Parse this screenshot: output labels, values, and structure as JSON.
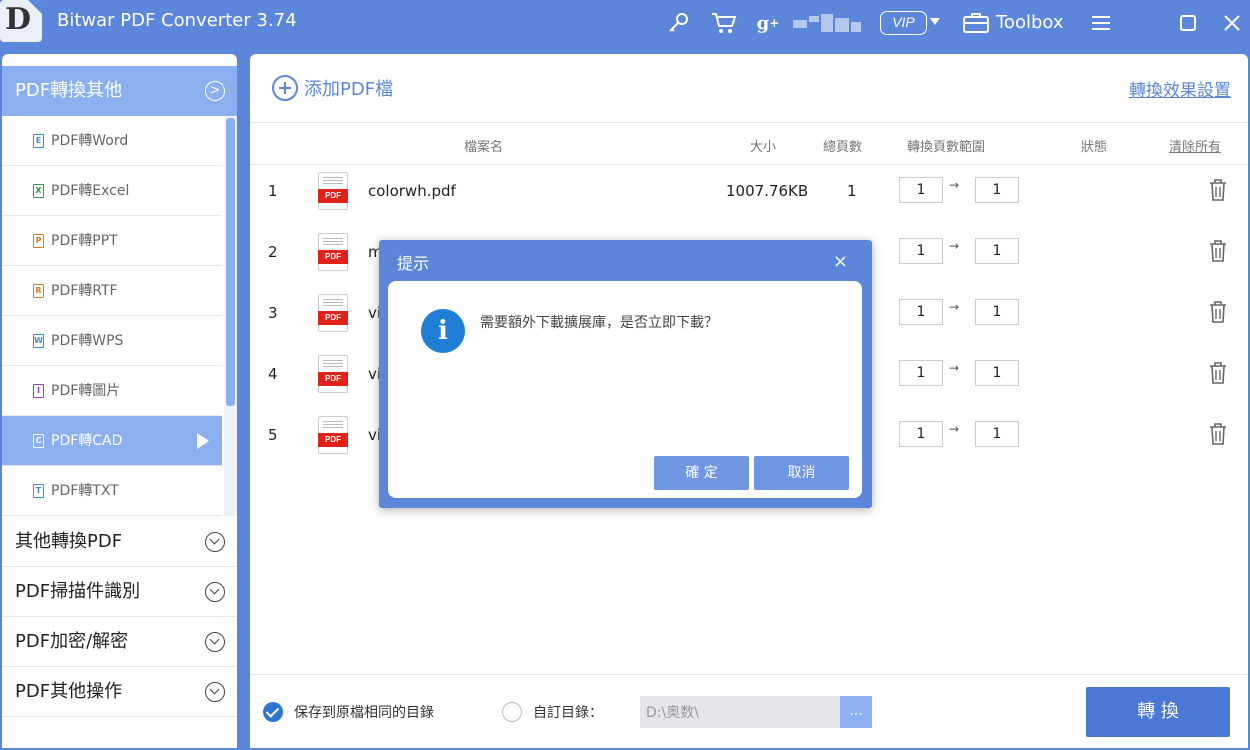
{
  "app": {
    "title": "Bitwar PDF Converter 3.74",
    "logo_letter": "D",
    "vip_label": "VIP",
    "toolbox_label": "Toolbox"
  },
  "icons": {
    "key": "key-icon",
    "cart": "cart-icon",
    "gplus": "google-plus-icon",
    "toolbox": "toolbox-icon",
    "menu": "menu-icon",
    "maximize": "maximize-icon",
    "close": "close-icon"
  },
  "sidebar": {
    "header": "PDF轉換其他",
    "items": [
      {
        "label": "PDF轉Word",
        "icon_letter": "E",
        "color": "#3f8ad9"
      },
      {
        "label": "PDF轉Excel",
        "icon_letter": "X",
        "color": "#2d9c48"
      },
      {
        "label": "PDF轉PPT",
        "icon_letter": "P",
        "color": "#e07a22"
      },
      {
        "label": "PDF轉RTF",
        "icon_letter": "R",
        "color": "#e07a22"
      },
      {
        "label": "PDF轉WPS",
        "icon_letter": "W",
        "color": "#3f8ad9"
      },
      {
        "label": "PDF轉圖片",
        "icon_letter": "I",
        "color": "#9b3fc9"
      },
      {
        "label": "PDF轉CAD",
        "icon_letter": "C",
        "color": "#ffffff"
      },
      {
        "label": "PDF轉TXT",
        "icon_letter": "T",
        "color": "#3f8ad9"
      }
    ],
    "sections": [
      "其他轉換PDF",
      "PDF掃描件識別",
      "PDF加密/解密",
      "PDF其他操作"
    ]
  },
  "main": {
    "add_label": "添加PDF檔",
    "settings_link": "轉換效果設置",
    "columns": {
      "name": "檔案名",
      "size": "大小",
      "pages": "總頁數",
      "range": "轉換頁數範圍",
      "status": "狀態",
      "clear": "清除所有"
    },
    "pdf_badge": "PDF",
    "rows": [
      {
        "num": "1",
        "name": "colorwh.pdf",
        "size": "1007.76KB",
        "pages": "1",
        "from": "1",
        "to": "1"
      },
      {
        "num": "2",
        "name": "m",
        "size": "",
        "pages": "",
        "from": "1",
        "to": "1"
      },
      {
        "num": "3",
        "name": "vi",
        "size": "",
        "pages": "",
        "from": "1",
        "to": "1"
      },
      {
        "num": "4",
        "name": "vi",
        "size": "",
        "pages": "",
        "from": "1",
        "to": "1"
      },
      {
        "num": "5",
        "name": "vi",
        "size": "",
        "pages": "",
        "from": "1",
        "to": "1"
      }
    ],
    "arrow_glyph": "→"
  },
  "bottom": {
    "save_same_label": "保存到原檔相同的目錄",
    "custom_dir_label": "自訂目錄：",
    "path_value": "D:\\奥数\\",
    "browse_label": "...",
    "convert_label": "轉 換"
  },
  "dialog": {
    "title": "提示",
    "close_glyph": "×",
    "message": "需要額外下載擴展庫，是否立即下載？",
    "info_glyph": "i",
    "ok_label": "確 定",
    "cancel_label": "取消"
  }
}
